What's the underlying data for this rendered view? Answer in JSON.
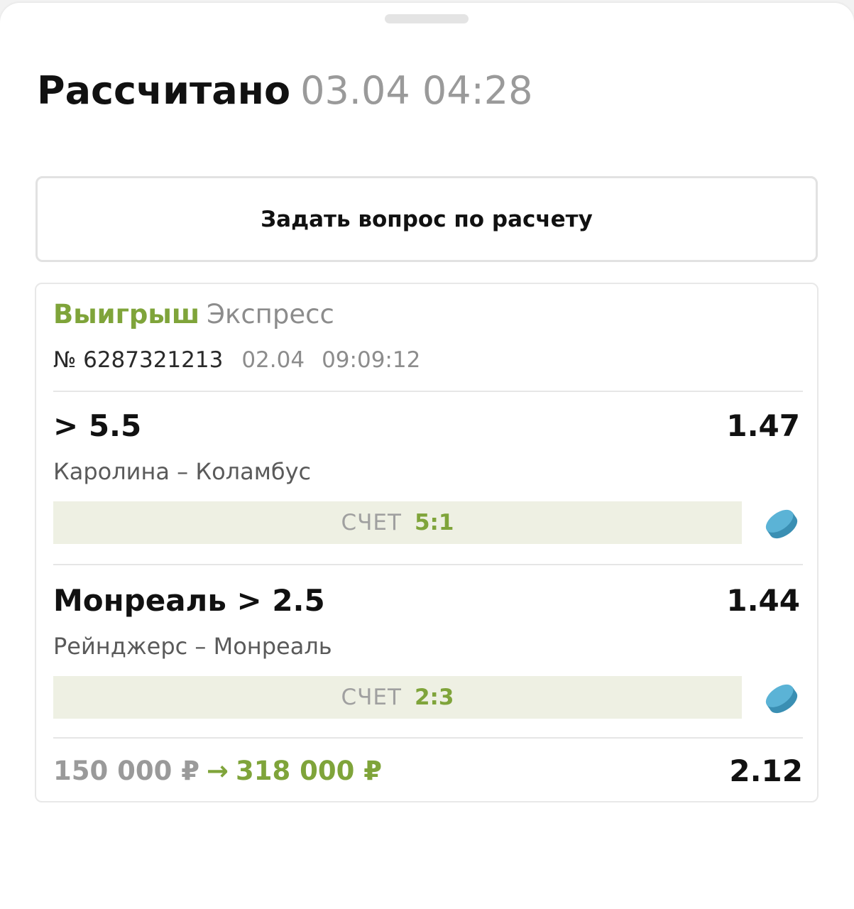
{
  "header": {
    "title": "Рассчитано",
    "datetime": "03.04 04:28"
  },
  "ask_button": {
    "label": "Задать вопрос по расчету"
  },
  "bet": {
    "status": "Выигрыш",
    "type": "Экспресс",
    "number": "№ 6287321213",
    "date": "02.04",
    "time": "09:09:12",
    "legs": [
      {
        "pick": "> 5.5",
        "odd": "1.47",
        "match": "Каролина – Коламбус",
        "score_label": "СЧЕТ",
        "score": "5:1",
        "sport_icon": "hockey-puck-icon"
      },
      {
        "pick": "Монреаль > 2.5",
        "odd": "1.44",
        "match": "Рейнджерс – Монреаль",
        "score_label": "СЧЕТ",
        "score": "2:3",
        "sport_icon": "hockey-puck-icon"
      }
    ],
    "stake": "150 000 ₽",
    "arrow": "→",
    "payout": "318 000 ₽",
    "total_odd": "2.12"
  },
  "colors": {
    "win_green": "#7fa43a",
    "score_bar_bg": "#eef0e3",
    "puck_blue": "#4aa3c7",
    "muted_text": "#9a9a9a"
  }
}
